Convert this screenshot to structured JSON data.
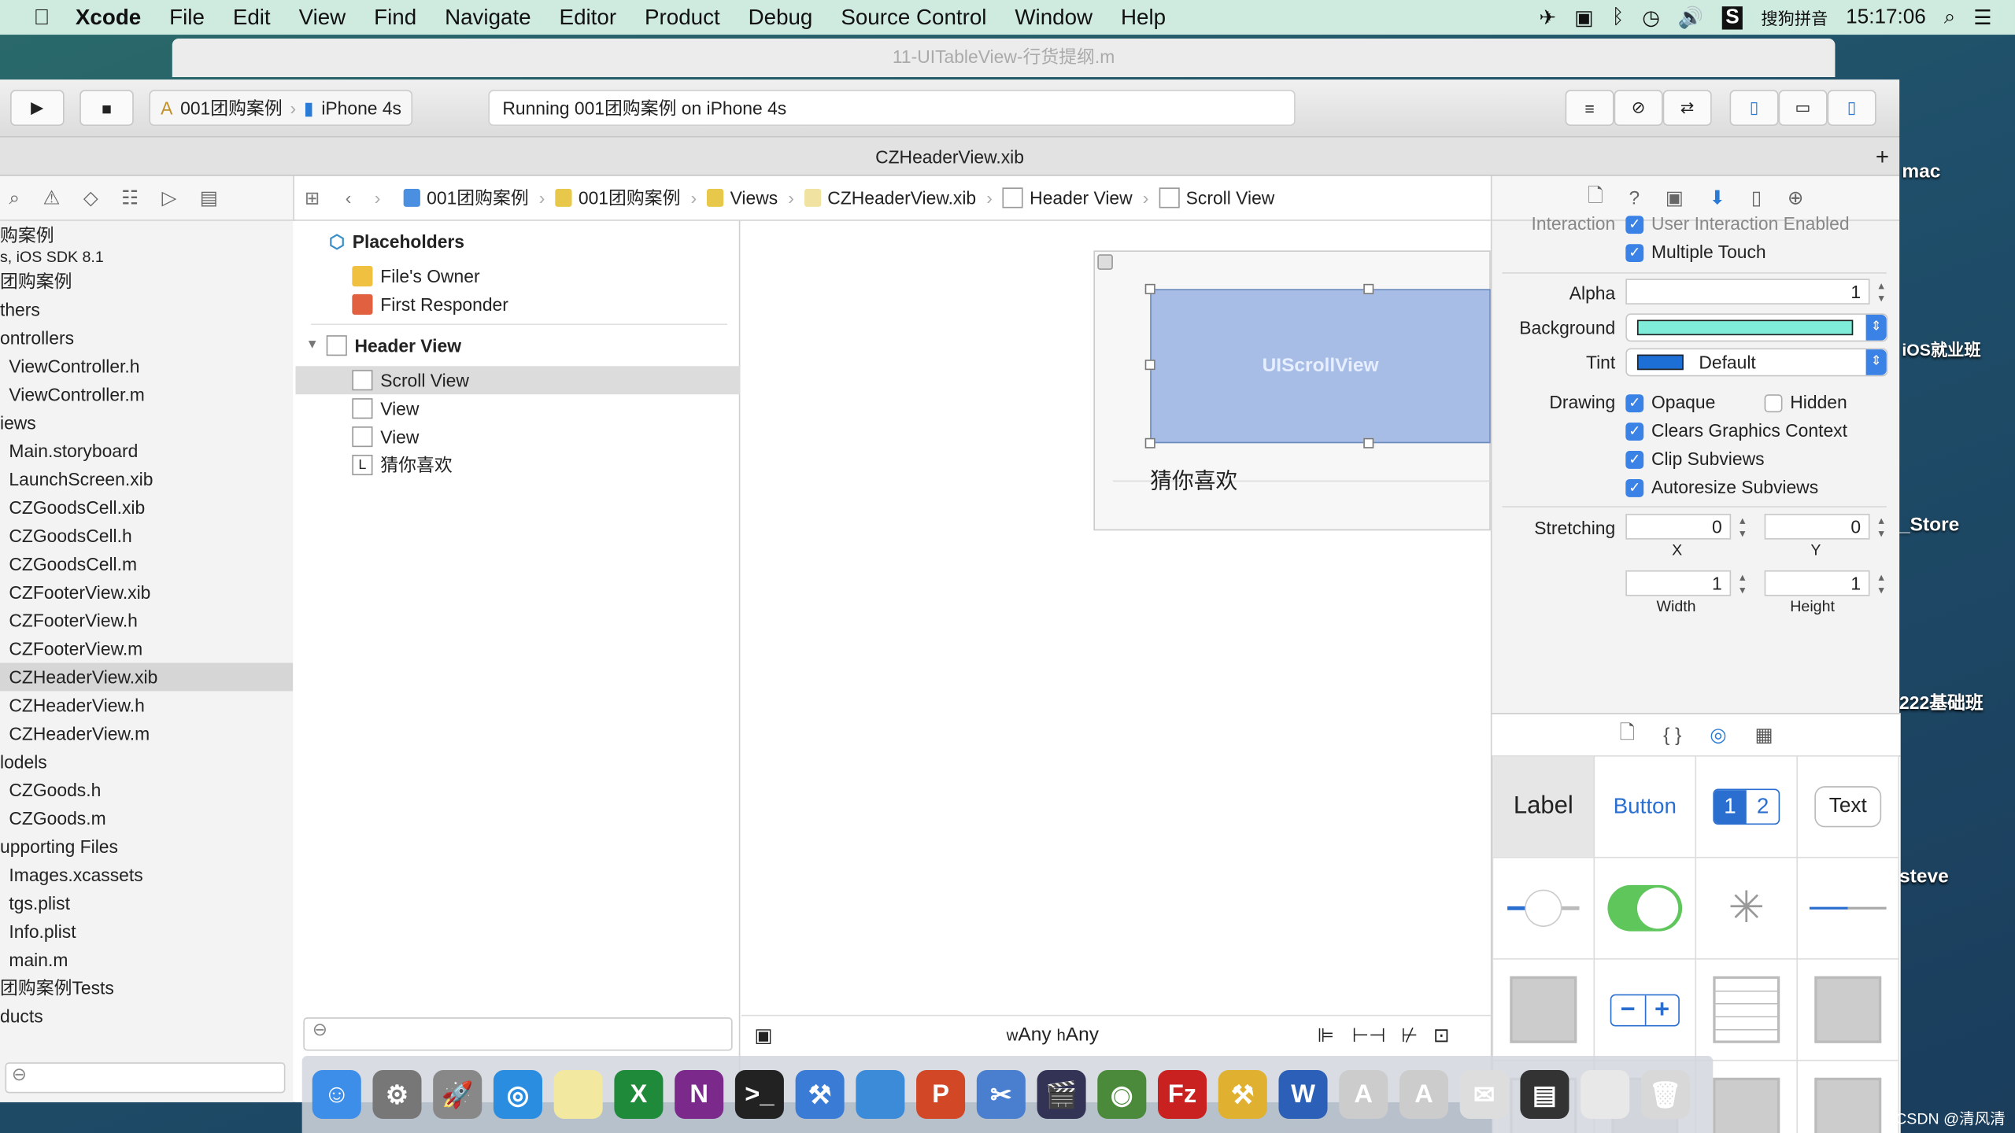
{
  "menubar": {
    "apple": "",
    "app": "Xcode",
    "items": [
      "File",
      "Edit",
      "View",
      "Find",
      "Navigate",
      "Editor",
      "Product",
      "Debug",
      "Source Control",
      "Window",
      "Help"
    ],
    "input_method": "搜狗拼音",
    "clock": "15:17:06"
  },
  "background_window": {
    "title": "11-UITableView-行货提纲.m"
  },
  "toolbar": {
    "scheme": "001团购案例",
    "device": "iPhone 4s",
    "status": "Running 001团购案例 on iPhone 4s"
  },
  "tab": {
    "title": "CZHeaderView.xib"
  },
  "jumpbar": [
    "001团购案例",
    "001团购案例",
    "Views",
    "CZHeaderView.xib",
    "Header View",
    "Scroll View"
  ],
  "navigator": {
    "items": [
      {
        "label": "购案例",
        "indent": 0
      },
      {
        "label": "s, iOS SDK 8.1",
        "indent": 0,
        "sub": true
      },
      {
        "label": "团购案例",
        "indent": 0
      },
      {
        "label": "thers",
        "indent": 0
      },
      {
        "label": "ontrollers",
        "indent": 0
      },
      {
        "label": "ViewController.h",
        "indent": 1
      },
      {
        "label": "ViewController.m",
        "indent": 1
      },
      {
        "label": "iews",
        "indent": 0
      },
      {
        "label": "Main.storyboard",
        "indent": 1
      },
      {
        "label": "LaunchScreen.xib",
        "indent": 1
      },
      {
        "label": "CZGoodsCell.xib",
        "indent": 1
      },
      {
        "label": "CZGoodsCell.h",
        "indent": 1
      },
      {
        "label": "CZGoodsCell.m",
        "indent": 1
      },
      {
        "label": "CZFooterView.xib",
        "indent": 1
      },
      {
        "label": "CZFooterView.h",
        "indent": 1
      },
      {
        "label": "CZFooterView.m",
        "indent": 1
      },
      {
        "label": "CZHeaderView.xib",
        "indent": 1,
        "selected": true
      },
      {
        "label": "CZHeaderView.h",
        "indent": 1
      },
      {
        "label": "CZHeaderView.m",
        "indent": 1
      },
      {
        "label": "lodels",
        "indent": 0
      },
      {
        "label": "CZGoods.h",
        "indent": 1
      },
      {
        "label": "CZGoods.m",
        "indent": 1
      },
      {
        "label": "upporting Files",
        "indent": 0
      },
      {
        "label": "Images.xcassets",
        "indent": 1
      },
      {
        "label": "tgs.plist",
        "indent": 1
      },
      {
        "label": "Info.plist",
        "indent": 1
      },
      {
        "label": "main.m",
        "indent": 1
      },
      {
        "label": "团购案例Tests",
        "indent": 0
      },
      {
        "label": "ducts",
        "indent": 0
      }
    ]
  },
  "outline": {
    "placeholders": "Placeholders",
    "files_owner": "File's Owner",
    "first_responder": "First Responder",
    "header_view": "Header View",
    "children": [
      "Scroll View",
      "View",
      "View",
      "猜你喜欢"
    ]
  },
  "canvas": {
    "scrollview_label": "UIScrollView",
    "label_text": "猜你喜欢",
    "size_class_w": "Any",
    "size_class_h": "Any",
    "w": "w",
    "h": "h"
  },
  "inspector": {
    "interaction_label": "Interaction",
    "user_interaction": "User Interaction Enabled",
    "multiple_touch": "Multiple Touch",
    "alpha_label": "Alpha",
    "alpha": "1",
    "background_label": "Background",
    "background_color": "#7eecd8",
    "tint_label": "Tint",
    "tint_value": "Default",
    "tint_color": "#1d6fd6",
    "drawing_label": "Drawing",
    "opaque": "Opaque",
    "hidden": "Hidden",
    "clears": "Clears Graphics Context",
    "clip": "Clip Subviews",
    "autoresize": "Autoresize Subviews",
    "stretching_label": "Stretching",
    "x": "0",
    "y": "0",
    "x_label": "X",
    "y_label": "Y",
    "width": "1",
    "height": "1",
    "width_label": "Width",
    "height_label": "Height",
    "checks": {
      "multiple_touch": true,
      "opaque": true,
      "hidden": false,
      "clears": true,
      "clip": true,
      "autoresize": true
    }
  },
  "library": {
    "label": "Label",
    "button": "Button",
    "seg1": "1",
    "seg2": "2",
    "text": "Text"
  },
  "dock": [
    {
      "name": "Finder",
      "color": "#3d8ee8",
      "glyph": "☺"
    },
    {
      "name": "System Preferences",
      "color": "#777",
      "glyph": "⚙"
    },
    {
      "name": "Launchpad",
      "color": "#888",
      "glyph": "🚀"
    },
    {
      "name": "Safari",
      "color": "#2a8de0",
      "glyph": "◎"
    },
    {
      "name": "Notes",
      "color": "#f3e8a0",
      "glyph": ""
    },
    {
      "name": "Excel",
      "color": "#1f8a3a",
      "glyph": "X"
    },
    {
      "name": "OneNote",
      "color": "#7b2a8c",
      "glyph": "N"
    },
    {
      "name": "Terminal",
      "color": "#222",
      "glyph": ">_"
    },
    {
      "name": "Xcode",
      "color": "#3a7bd5",
      "glyph": "⚒"
    },
    {
      "name": "Folder",
      "color": "#3c8bd8",
      "glyph": ""
    },
    {
      "name": "PowerPoint",
      "color": "#d24726",
      "glyph": "P"
    },
    {
      "name": "Instruments",
      "color": "#4a7fd0",
      "glyph": "✂"
    },
    {
      "name": "Movie",
      "color": "#335",
      "glyph": "🎬"
    },
    {
      "name": "Network",
      "color": "#4a8a3a",
      "glyph": "◉"
    },
    {
      "name": "FileZilla",
      "color": "#c92020",
      "glyph": "Fz"
    },
    {
      "name": "Tools",
      "color": "#e0b030",
      "glyph": "⚒"
    },
    {
      "name": "Word",
      "color": "#2b5fb8",
      "glyph": "W"
    },
    {
      "name": "Preview",
      "color": "#ccc",
      "glyph": "A"
    },
    {
      "name": "Instruments 2",
      "color": "#ccc",
      "glyph": "A"
    },
    {
      "name": "Mail",
      "color": "#ddd",
      "glyph": "✉"
    },
    {
      "name": "Printer",
      "color": "#333",
      "glyph": "▤"
    },
    {
      "name": "Downloads",
      "color": "#e8e8e8",
      "glyph": ""
    },
    {
      "name": "Trash",
      "color": "#d8d8d8",
      "glyph": "🗑"
    }
  ],
  "desktop": {
    "labels": [
      "mac",
      "iOS就业班",
      "_Store",
      "222基础班",
      "steve"
    ]
  },
  "watermark": "CSDN @清风清晨"
}
